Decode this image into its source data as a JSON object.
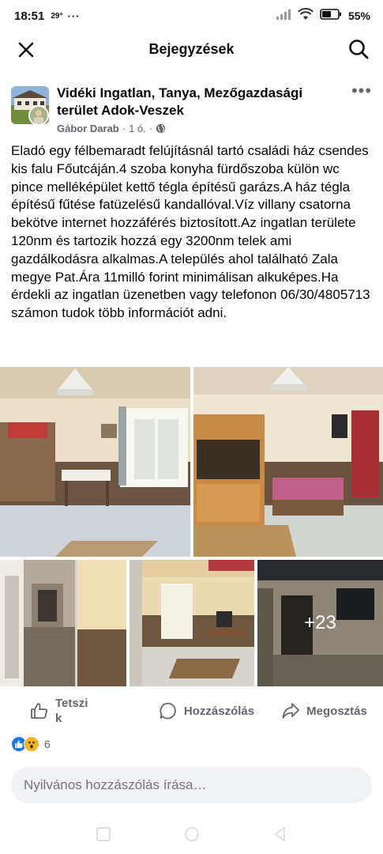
{
  "status_bar": {
    "time": "18:51",
    "temperature": "29°",
    "dots": "···",
    "battery": "55%"
  },
  "header": {
    "title": "Bejegyzések",
    "close_icon": "close-icon",
    "search_icon": "search-icon"
  },
  "post": {
    "group_name": "Vidéki Ingatlan, Tanya, Mezőgazdasági terület Adok-Veszek",
    "author": "Gábor Darab",
    "separator": "·",
    "time": "1 ó.",
    "audience_icon": "globe-icon",
    "more_icon": "more-icon",
    "more_label": "•••",
    "text": "Eladó egy félbemaradt felújításnál tartó családi ház csendes kis falu Főutcáján.4 szoba konyha fürdőszoba külön wc pince melléképület kettő tégla építésű garázs.A ház tégla építésű fűtése fatüzelésű kandallóval.Víz villany csatorna bekötve internet hozzáférés biztosított.Az ingatlan területe 120nm és tartozik hozzá egy 3200nm telek ami gazdálkodásra alkalmas.A település ahol található Zala megye Pat.Ára 11milló forint minimálisan alkuképes.Ha érdekli az ingatlan üzenetben vagy telefonon 06/30/4805713 számon tudok több információt adni.",
    "more_photos": "+23"
  },
  "actions": {
    "like": "Tetszik",
    "comment": "Hozzászólás",
    "share": "Megosztás"
  },
  "reactions": {
    "count": "6"
  },
  "comment": {
    "placeholder": "Nyilvános hozzászólás írása…"
  },
  "colors": {
    "facebook_blue": "#1877f2",
    "wow_yellow": "#f7b125",
    "secondary_text": "#65676b",
    "input_bg": "#f0f2f5"
  }
}
